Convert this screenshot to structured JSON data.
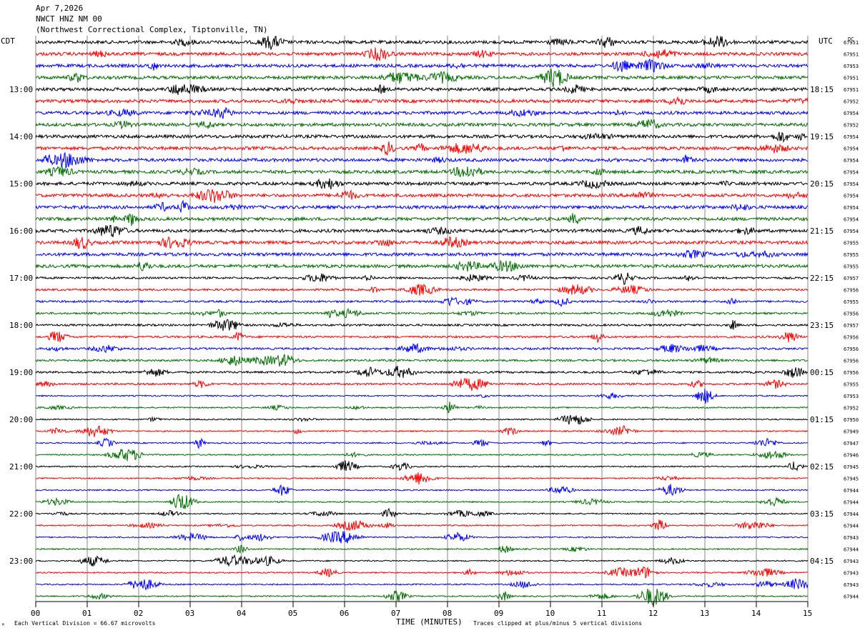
{
  "header": {
    "date": "Apr 7,2026",
    "station": "NWCT HNZ NM 00",
    "location": "(Northwest Correctional Complex, Tiptonville, TN)"
  },
  "left_tz": "CDT",
  "right_tz": "UTC",
  "dc_label": "DC",
  "footer": {
    "scale": "Each Vertical Division =   66.67 microvolts",
    "clip": "Traces clipped at plus/minus 5 vertical divisions",
    "corner": "ᴹ"
  },
  "colors": [
    "#000000",
    "#ff0000",
    "#0000ff",
    "#007000"
  ],
  "chart_data": {
    "type": "line",
    "xlabel": "TIME (MINUTES)",
    "x_ticks": [
      "00",
      "01",
      "02",
      "03",
      "04",
      "05",
      "06",
      "07",
      "08",
      "09",
      "10",
      "11",
      "12",
      "13",
      "14",
      "15"
    ],
    "xlim": [
      0,
      15
    ],
    "rows_per_hour": 4,
    "left_labels": [
      "13:00",
      "14:00",
      "15:00",
      "16:00",
      "17:00",
      "18:00",
      "19:00",
      "20:00",
      "21:00",
      "22:00",
      "23:00"
    ],
    "right_labels": [
      "18:15",
      "19:15",
      "20:15",
      "21:15",
      "22:15",
      "23:15",
      "00:15",
      "01:15",
      "02:15",
      "03:15",
      "04:15"
    ],
    "dc_values": [
      67951,
      67951,
      67953,
      67951,
      67951,
      67952,
      67954,
      67952,
      67954,
      67954,
      67954,
      67954,
      67954,
      67954,
      67954,
      67954,
      67954,
      67955,
      67955,
      67955,
      67957,
      67956,
      67955,
      67956,
      67957,
      67956,
      67956,
      67956,
      67956,
      67955,
      67953,
      67952,
      67950,
      67949,
      67947,
      67946,
      67945,
      67945,
      67944,
      67944,
      67944,
      67944,
      67943,
      67944,
      67943,
      67943,
      67943,
      67944
    ],
    "grid": true
  }
}
